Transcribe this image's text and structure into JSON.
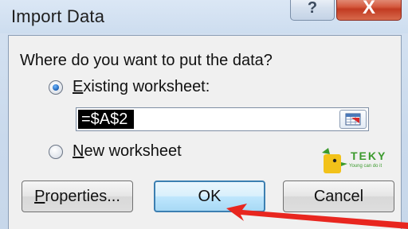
{
  "window": {
    "title": "Import Data",
    "help_label": "?",
    "close_label": "X"
  },
  "main": {
    "question": "Where do you want to put the data?",
    "options": [
      {
        "label_prefix": "",
        "label_mnemonic": "E",
        "label_rest": "xisting worksheet:",
        "selected": true
      },
      {
        "label_prefix": "",
        "label_mnemonic": "N",
        "label_rest": "ew worksheet",
        "selected": false
      }
    ],
    "reference_value": "=$A$2"
  },
  "buttons": {
    "properties_mnemonic": "P",
    "properties_rest": "roperties...",
    "ok_label": "OK",
    "cancel_label": "Cancel"
  },
  "watermark": {
    "brand": "TEKY",
    "tagline": "Young can do it"
  },
  "colors": {
    "accent_arrow": "#e8261f",
    "ok_border": "#3c7fb1",
    "logo_green": "#3b9a2d",
    "logo_yellow": "#f2c21a"
  },
  "icons": {
    "collapse_dialog": "range-selector-icon",
    "annotation": "red-arrow-icon"
  }
}
